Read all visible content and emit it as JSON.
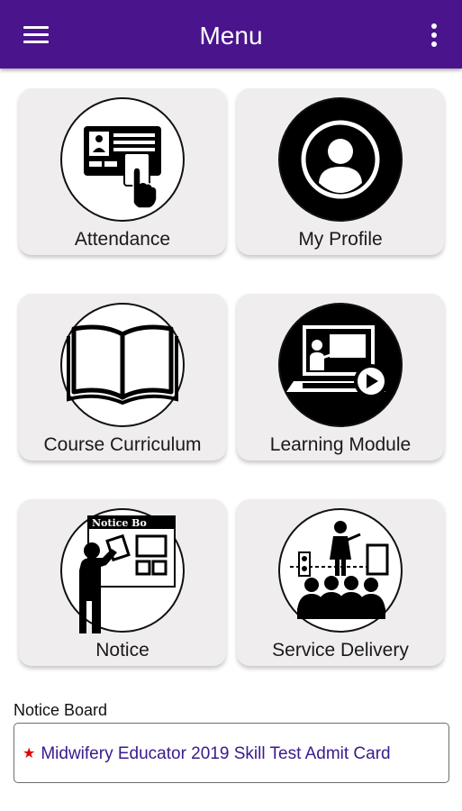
{
  "app_bar": {
    "title": "Menu",
    "background": "#4a148c",
    "menu_icon": "hamburger-icon",
    "overflow_icon": "more-vert-icon"
  },
  "menu": {
    "items": [
      {
        "label": "Attendance",
        "icon": "attendance-card-icon"
      },
      {
        "label": "My Profile",
        "icon": "profile-icon"
      },
      {
        "label": "Course Curriculum",
        "icon": "open-book-icon"
      },
      {
        "label": "Learning Module",
        "icon": "video-lesson-icon"
      },
      {
        "label": "Notice",
        "icon": "notice-board-icon"
      },
      {
        "label": "Service Delivery",
        "icon": "service-delivery-icon"
      }
    ],
    "notice_board_sign": "Notice Bo"
  },
  "notice_board": {
    "title": "Notice Board",
    "items": [
      {
        "bullet": "★",
        "text": "Midwifery Educator 2019 Skill Test Admit Card"
      }
    ]
  }
}
